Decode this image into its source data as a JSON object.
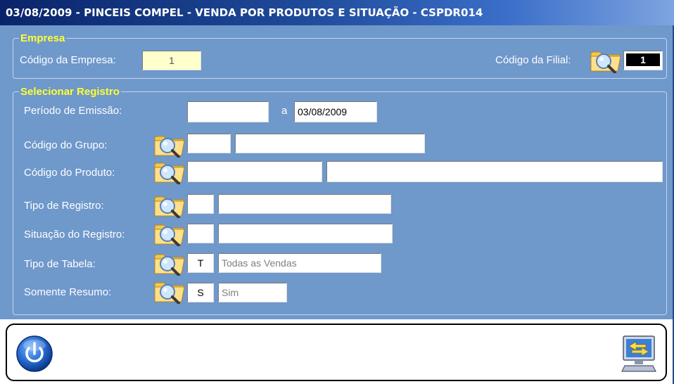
{
  "window": {
    "title": "03/08/2009 - PINCEIS COMPEL - VENDA POR PRODUTOS E SITUAÇÃO - CSPDR014"
  },
  "empresa": {
    "legend": "Empresa",
    "codigo_empresa_label": "Código da Empresa:",
    "codigo_empresa_value": "1",
    "codigo_filial_label": "Código da Filial:",
    "codigo_filial_value": "1"
  },
  "registro": {
    "legend": "Selecionar Registro",
    "periodo_label": "Período de Emissão:",
    "periodo_inicio": "",
    "periodo_sep": "a",
    "periodo_fim": "03/08/2009",
    "grupo_label": "Código do Grupo:",
    "grupo_code": "",
    "grupo_desc": "",
    "produto_label": "Código do Produto:",
    "produto_code": "",
    "produto_desc": "",
    "tipo_registro_label": "Tipo de Registro:",
    "tipo_registro_code": "",
    "tipo_registro_desc": "",
    "situacao_label": "Situação do Registro:",
    "situacao_code": "",
    "situacao_desc": "",
    "tipo_tabela_label": "Tipo de Tabela:",
    "tipo_tabela_code": "T",
    "tipo_tabela_desc": "Todas as Vendas",
    "resumo_label": "Somente Resumo:",
    "resumo_code": "S",
    "resumo_desc": "Sim"
  },
  "icons": {
    "search": "folder-magnifier-icon",
    "power": "power-icon",
    "export": "export-computer-icon"
  },
  "colors": {
    "panel": "#6f98cb",
    "legend": "#ffff33",
    "titlebar": "#0a246a"
  }
}
